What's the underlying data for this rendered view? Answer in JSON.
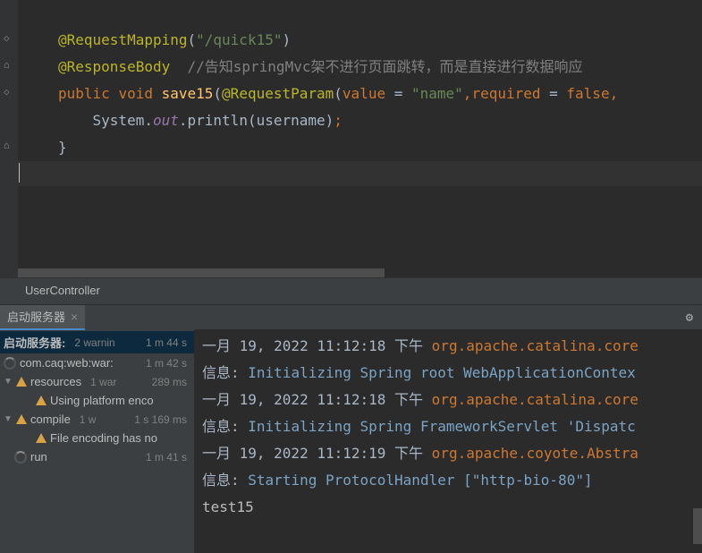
{
  "code": {
    "line1_anno": "@RequestMapping",
    "line1_open": "(",
    "line1_str": "\"/quick15\"",
    "line1_close": ")",
    "line2_anno": "@ResponseBody",
    "line2_comment": "  //告知springMvc架不进行页面跳转，而是直接进行数据响应",
    "line3_kw1": "public",
    "line3_kw2": "void",
    "line3_name": "save15",
    "line3_open": "(",
    "line3_anno": "@RequestParam",
    "line3_open2": "(",
    "line3_kw3": "value",
    "line3_eq": " = ",
    "line3_str": "\"name\"",
    "line3_comma": ",",
    "line3_kw4": "required",
    "line3_eq2": " = ",
    "line3_kw5": "false",
    "line3_comma2": ",",
    "line4_sys": "System",
    "line4_dot1": ".",
    "line4_out": "out",
    "line4_dot2": ".",
    "line4_method": "println",
    "line4_open": "(",
    "line4_arg": "username",
    "line4_close": ")",
    "line4_semi": ";",
    "line5_brace": "}"
  },
  "breadcrumb": "UserController",
  "tab": {
    "label": "启动服务器",
    "close": "×"
  },
  "tasks": {
    "root_label": "启动服务器:",
    "root_meta1": "2 warnin",
    "root_meta2": "1 m 44 s",
    "web_label": "com.caq:web:war:",
    "web_meta": "1 m 42 s",
    "res_label": "resources",
    "res_meta1": "1 war",
    "res_meta2": "289 ms",
    "res_detail": "Using platform enco",
    "compile_label": "compile",
    "compile_meta1": "1 w",
    "compile_meta2": "1 s 169 ms",
    "compile_detail": "File encoding has no",
    "run_label": "run",
    "run_meta": "1 m 41 s"
  },
  "console": {
    "l1_date": "一月 19, 2022 11:12:18 下午 ",
    "l1_class": "org.apache.catalina.core",
    "l2_prefix": "信息: ",
    "l2_msg": "Initializing Spring root WebApplicationContex",
    "l3_date": "一月 19, 2022 11:12:18 下午 ",
    "l3_class": "org.apache.catalina.core",
    "l4_prefix": "信息: ",
    "l4_msg": "Initializing Spring FrameworkServlet 'Dispatc",
    "l5_date": "一月 19, 2022 11:12:19 下午 ",
    "l5_class": "org.apache.coyote.Abstra",
    "l6_prefix": "信息: ",
    "l6_msg": "Starting ProtocolHandler [\"http-bio-80\"]",
    "l7": "test15"
  }
}
